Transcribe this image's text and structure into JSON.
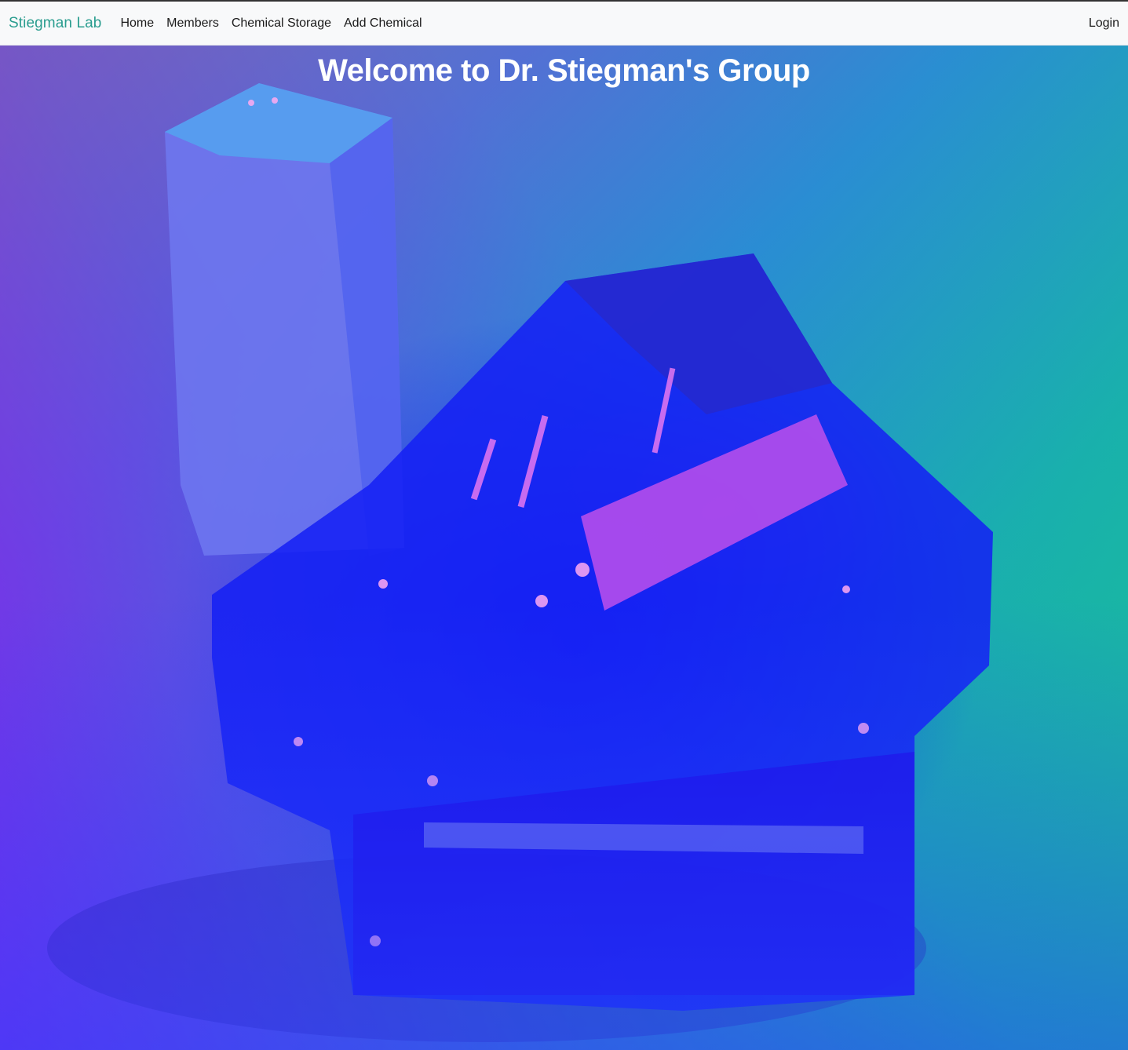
{
  "navbar": {
    "brand": "Stiegman Lab",
    "links": [
      {
        "label": "Home"
      },
      {
        "label": "Members"
      },
      {
        "label": "Chemical Storage"
      },
      {
        "label": "Add Chemical"
      }
    ],
    "login_label": "Login"
  },
  "hero": {
    "title": "Welcome to Dr. Stiegman's Group",
    "image": "crystal-photo"
  },
  "colors": {
    "brand": "#2a9d8f",
    "navbar_bg": "#f8f9fa",
    "hero_primary": "#1a24f0",
    "hero_accent_green": "#17c98a",
    "hero_accent_purple": "#8c14f0"
  }
}
